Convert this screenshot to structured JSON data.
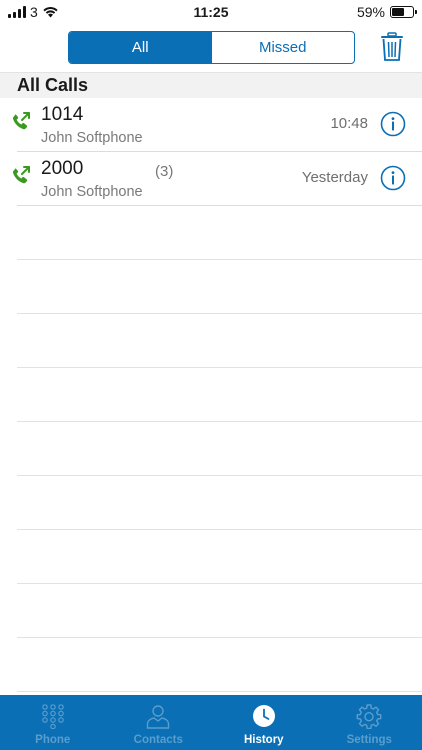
{
  "status_bar": {
    "carrier": "3",
    "time": "11:25",
    "battery": "59%",
    "battery_level": 0.59
  },
  "header": {
    "segments": [
      {
        "label": "All",
        "active": true
      },
      {
        "label": "Missed",
        "active": false
      }
    ],
    "trash_icon": "trash-icon"
  },
  "section": {
    "title": "All Calls"
  },
  "calls": [
    {
      "number": "1014",
      "count": "",
      "name": "John Softphone",
      "time": "10:48",
      "icon": "outgoing-call-icon"
    },
    {
      "number": "2000",
      "count": "(3)",
      "name": "John Softphone",
      "time": "Yesterday",
      "icon": "outgoing-call-icon"
    }
  ],
  "tabs": [
    {
      "label": "Phone",
      "icon": "keypad-icon",
      "active": false
    },
    {
      "label": "Contacts",
      "icon": "contacts-icon",
      "active": false
    },
    {
      "label": "History",
      "icon": "clock-icon",
      "active": true
    },
    {
      "label": "Settings",
      "icon": "gear-icon",
      "active": false
    }
  ],
  "colors": {
    "accent": "#0a6fb5",
    "call_icon": "#3a9a1f",
    "tab_inactive": "#5b9dcc"
  }
}
